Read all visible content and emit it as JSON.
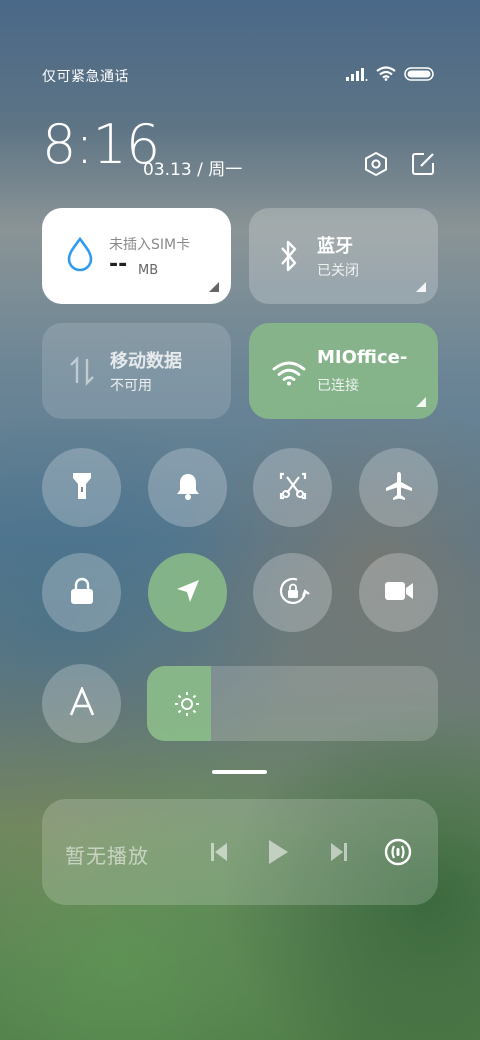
{
  "status_bar": {
    "carrier_text": "仅可紧急通话",
    "icons": [
      "signal-icon",
      "wifi-icon",
      "battery-icon"
    ]
  },
  "header": {
    "time": "8:16",
    "date": "03.13 / 周一",
    "icons": [
      "settings-icon",
      "edit-icon"
    ]
  },
  "tiles": {
    "data_usage": {
      "title": "未插入SIM卡",
      "value": "--",
      "unit": "MB",
      "icon": "water-drop-icon"
    },
    "bluetooth": {
      "title": "蓝牙",
      "status": "已关闭",
      "icon": "bluetooth-icon"
    },
    "mobile_data": {
      "title": "移动数据",
      "status": "不可用",
      "icon": "data-arrows-icon"
    },
    "wifi": {
      "title": "MIOffice-",
      "status": "已连接",
      "icon": "wifi-icon",
      "active": true
    }
  },
  "toggles": [
    {
      "name": "flashlight",
      "icon": "flashlight-icon",
      "active": false
    },
    {
      "name": "mute",
      "icon": "bell-icon",
      "active": false
    },
    {
      "name": "screenshot",
      "icon": "scissors-icon",
      "active": false
    },
    {
      "name": "airplane",
      "icon": "airplane-icon",
      "active": false
    },
    {
      "name": "lock-screen",
      "icon": "lock-icon",
      "active": false
    },
    {
      "name": "location",
      "icon": "location-arrow-icon",
      "active": true
    },
    {
      "name": "rotation-lock",
      "icon": "rotation-lock-icon",
      "active": false
    },
    {
      "name": "screen-record",
      "icon": "video-camera-icon",
      "active": false
    },
    {
      "name": "reading-mode",
      "icon": "letter-a-icon",
      "active": false
    }
  ],
  "brightness": {
    "level_percent": 22,
    "icon": "sun-icon"
  },
  "media": {
    "status": "暂无播放",
    "controls": [
      "previous-icon",
      "play-icon",
      "next-icon",
      "audio-output-icon"
    ]
  },
  "colors": {
    "accent_green": "#88b888",
    "tile_white": "#ffffff",
    "wifi_drop_blue": "#2f9cf2"
  }
}
